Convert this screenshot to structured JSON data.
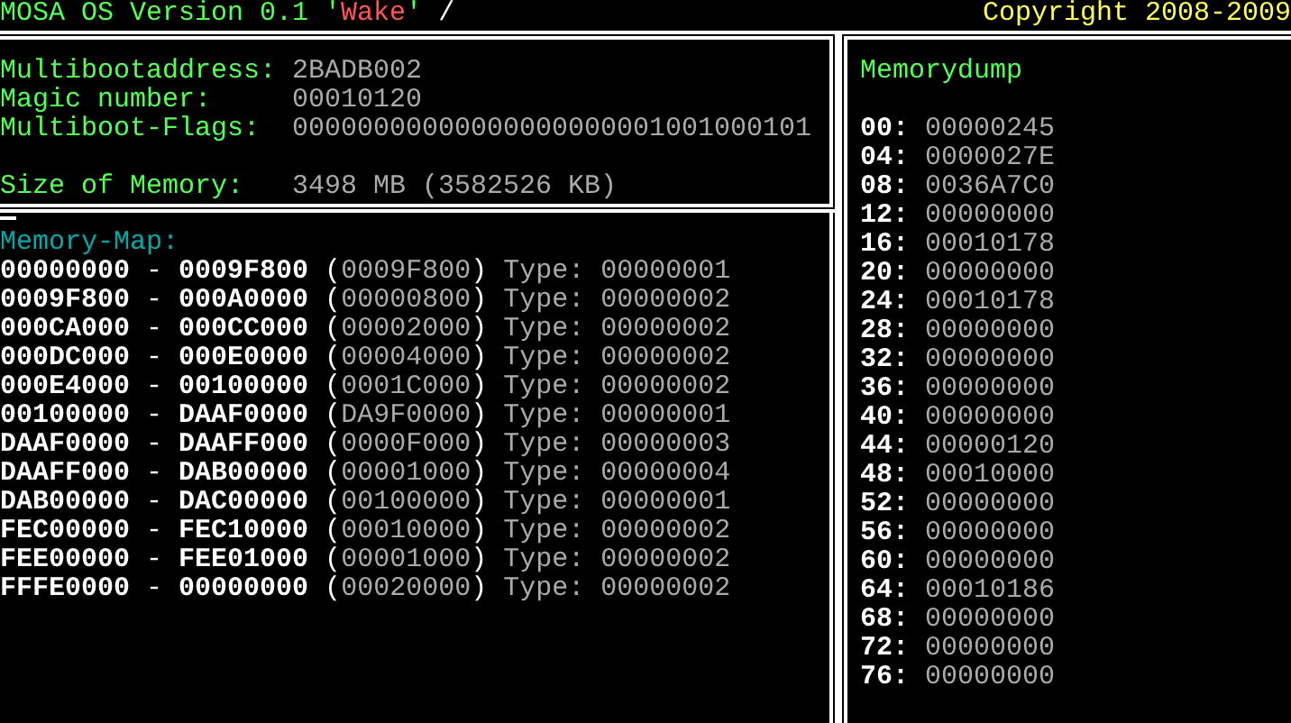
{
  "header": {
    "title": "MOSA OS Version 0.1 '",
    "codename": "Wake",
    "title_end": "'",
    "spinner": "/",
    "copyright": "Copyright 2008-2009"
  },
  "boot_info": [
    {
      "label": "Multibootaddress:",
      "value": "2BADB002"
    },
    {
      "label": "Magic number:",
      "value": "00010120"
    },
    {
      "label": "Multiboot-Flags:",
      "value": "00000000000000000000001001000101"
    }
  ],
  "memory_size": {
    "label": "Size of Memory:",
    "value": "3498 MB (3582526 KB)"
  },
  "memory_map": {
    "title": "Memory-Map:",
    "entries": [
      {
        "start": "00000000",
        "sep": "-",
        "end": "0009F800",
        "open": "(",
        "length": "0009F800",
        "close": ")",
        "type_label": "Type:",
        "type": "00000001"
      },
      {
        "start": "0009F800",
        "sep": "-",
        "end": "000A0000",
        "open": "(",
        "length": "00000800",
        "close": ")",
        "type_label": "Type:",
        "type": "00000002"
      },
      {
        "start": "000CA000",
        "sep": "-",
        "end": "000CC000",
        "open": "(",
        "length": "00002000",
        "close": ")",
        "type_label": "Type:",
        "type": "00000002"
      },
      {
        "start": "000DC000",
        "sep": "-",
        "end": "000E0000",
        "open": "(",
        "length": "00004000",
        "close": ")",
        "type_label": "Type:",
        "type": "00000002"
      },
      {
        "start": "000E4000",
        "sep": "-",
        "end": "00100000",
        "open": "(",
        "length": "0001C000",
        "close": ")",
        "type_label": "Type:",
        "type": "00000002"
      },
      {
        "start": "00100000",
        "sep": "-",
        "end": "DAAF0000",
        "open": "(",
        "length": "DA9F0000",
        "close": ")",
        "type_label": "Type:",
        "type": "00000001"
      },
      {
        "start": "DAAF0000",
        "sep": "-",
        "end": "DAAFF000",
        "open": "(",
        "length": "0000F000",
        "close": ")",
        "type_label": "Type:",
        "type": "00000003"
      },
      {
        "start": "DAAFF000",
        "sep": "-",
        "end": "DAB00000",
        "open": "(",
        "length": "00001000",
        "close": ")",
        "type_label": "Type:",
        "type": "00000004"
      },
      {
        "start": "DAB00000",
        "sep": "-",
        "end": "DAC00000",
        "open": "(",
        "length": "00100000",
        "close": ")",
        "type_label": "Type:",
        "type": "00000001"
      },
      {
        "start": "FEC00000",
        "sep": "-",
        "end": "FEC10000",
        "open": "(",
        "length": "00010000",
        "close": ")",
        "type_label": "Type:",
        "type": "00000002"
      },
      {
        "start": "FEE00000",
        "sep": "-",
        "end": "FEE01000",
        "open": "(",
        "length": "00001000",
        "close": ")",
        "type_label": "Type:",
        "type": "00000002"
      },
      {
        "start": "FFFE0000",
        "sep": "-",
        "end": "00000000",
        "open": "(",
        "length": "00020000",
        "close": ")",
        "type_label": "Type:",
        "type": "00000002"
      }
    ]
  },
  "memory_dump": {
    "title": "Memorydump",
    "rows": [
      {
        "offset": "00:",
        "value": "00000245"
      },
      {
        "offset": "04:",
        "value": "0000027E"
      },
      {
        "offset": "08:",
        "value": "0036A7C0"
      },
      {
        "offset": "12:",
        "value": "00000000"
      },
      {
        "offset": "16:",
        "value": "00010178"
      },
      {
        "offset": "20:",
        "value": "00000000"
      },
      {
        "offset": "24:",
        "value": "00010178"
      },
      {
        "offset": "28:",
        "value": "00000000"
      },
      {
        "offset": "32:",
        "value": "00000000"
      },
      {
        "offset": "36:",
        "value": "00000000"
      },
      {
        "offset": "40:",
        "value": "00000000"
      },
      {
        "offset": "44:",
        "value": "00000120"
      },
      {
        "offset": "48:",
        "value": "00010000"
      },
      {
        "offset": "52:",
        "value": "00000000"
      },
      {
        "offset": "56:",
        "value": "00000000"
      },
      {
        "offset": "60:",
        "value": "00000000"
      },
      {
        "offset": "64:",
        "value": "00010186"
      },
      {
        "offset": "68:",
        "value": "00000000"
      },
      {
        "offset": "72:",
        "value": "00000000"
      },
      {
        "offset": "76:",
        "value": "00000000"
      }
    ]
  }
}
